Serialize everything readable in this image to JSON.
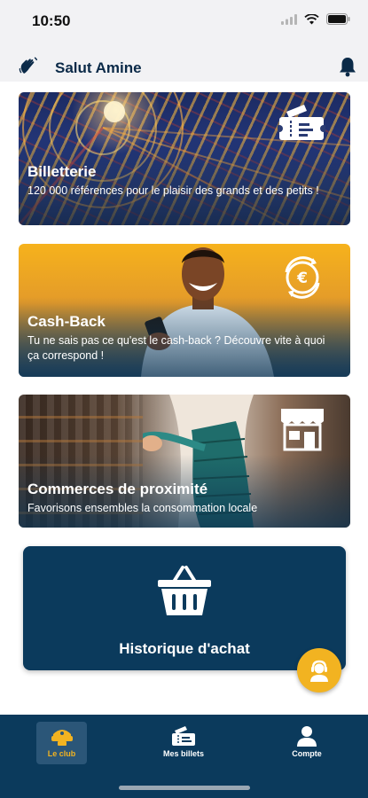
{
  "status": {
    "time": "10:50"
  },
  "header": {
    "greeting": "Salut Amine",
    "wave_icon": "wave-hand-icon",
    "bell_icon": "bell-icon"
  },
  "cards": [
    {
      "title": "Billetterie",
      "description": "120 000 références pour le plaisir des grands et des petits !",
      "icon": "ticket-icon"
    },
    {
      "title": "Cash-Back",
      "description": "Tu ne sais pas ce qu'est le cash-back ? Découvre vite à quoi ça correspond !",
      "icon": "euro-cycle-icon"
    },
    {
      "title": "Commerces de proximité",
      "description": "Favorisons ensembles la consommation locale",
      "icon": "shop-icon"
    }
  ],
  "history": {
    "title": "Historique d'achat",
    "icon": "basket-icon"
  },
  "fab": {
    "icon": "support-agent-icon"
  },
  "nav": {
    "items": [
      {
        "label": "Le club",
        "icon": "club-badge-icon",
        "active": true
      },
      {
        "label": "Mes billets",
        "icon": "tickets-icon",
        "active": false
      },
      {
        "label": "Compte",
        "icon": "user-icon",
        "active": false
      }
    ]
  },
  "colors": {
    "primary": "#0b3a5c",
    "accent": "#f2b321",
    "header_bg": "#f2f2f4"
  }
}
